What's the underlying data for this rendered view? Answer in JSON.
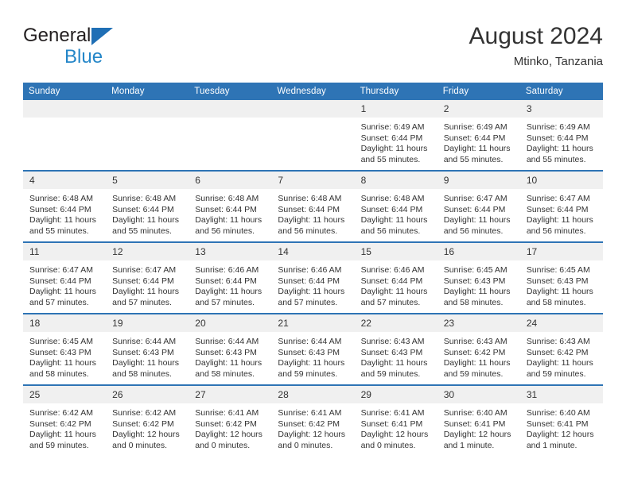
{
  "brand": {
    "name_part1": "General",
    "name_part2": "Blue",
    "mark": "triangle-logo",
    "colors": {
      "dark": "#231f20",
      "blue": "#2486c8",
      "mark": "#1f6fb5"
    }
  },
  "header": {
    "title": "August 2024",
    "location": "Mtinko, Tanzania"
  },
  "theme": {
    "header_blue": "#2e74b5",
    "daynum_band": "#f0f0f0",
    "text": "#333333"
  },
  "calendar": {
    "weekday_headers": [
      "Sunday",
      "Monday",
      "Tuesday",
      "Wednesday",
      "Thursday",
      "Friday",
      "Saturday"
    ],
    "weeks": [
      [
        {
          "day": "",
          "lines": []
        },
        {
          "day": "",
          "lines": []
        },
        {
          "day": "",
          "lines": []
        },
        {
          "day": "",
          "lines": []
        },
        {
          "day": "1",
          "lines": [
            "Sunrise: 6:49 AM",
            "Sunset: 6:44 PM",
            "Daylight: 11 hours and 55 minutes."
          ]
        },
        {
          "day": "2",
          "lines": [
            "Sunrise: 6:49 AM",
            "Sunset: 6:44 PM",
            "Daylight: 11 hours and 55 minutes."
          ]
        },
        {
          "day": "3",
          "lines": [
            "Sunrise: 6:49 AM",
            "Sunset: 6:44 PM",
            "Daylight: 11 hours and 55 minutes."
          ]
        }
      ],
      [
        {
          "day": "4",
          "lines": [
            "Sunrise: 6:48 AM",
            "Sunset: 6:44 PM",
            "Daylight: 11 hours and 55 minutes."
          ]
        },
        {
          "day": "5",
          "lines": [
            "Sunrise: 6:48 AM",
            "Sunset: 6:44 PM",
            "Daylight: 11 hours and 55 minutes."
          ]
        },
        {
          "day": "6",
          "lines": [
            "Sunrise: 6:48 AM",
            "Sunset: 6:44 PM",
            "Daylight: 11 hours and 56 minutes."
          ]
        },
        {
          "day": "7",
          "lines": [
            "Sunrise: 6:48 AM",
            "Sunset: 6:44 PM",
            "Daylight: 11 hours and 56 minutes."
          ]
        },
        {
          "day": "8",
          "lines": [
            "Sunrise: 6:48 AM",
            "Sunset: 6:44 PM",
            "Daylight: 11 hours and 56 minutes."
          ]
        },
        {
          "day": "9",
          "lines": [
            "Sunrise: 6:47 AM",
            "Sunset: 6:44 PM",
            "Daylight: 11 hours and 56 minutes."
          ]
        },
        {
          "day": "10",
          "lines": [
            "Sunrise: 6:47 AM",
            "Sunset: 6:44 PM",
            "Daylight: 11 hours and 56 minutes."
          ]
        }
      ],
      [
        {
          "day": "11",
          "lines": [
            "Sunrise: 6:47 AM",
            "Sunset: 6:44 PM",
            "Daylight: 11 hours and 57 minutes."
          ]
        },
        {
          "day": "12",
          "lines": [
            "Sunrise: 6:47 AM",
            "Sunset: 6:44 PM",
            "Daylight: 11 hours and 57 minutes."
          ]
        },
        {
          "day": "13",
          "lines": [
            "Sunrise: 6:46 AM",
            "Sunset: 6:44 PM",
            "Daylight: 11 hours and 57 minutes."
          ]
        },
        {
          "day": "14",
          "lines": [
            "Sunrise: 6:46 AM",
            "Sunset: 6:44 PM",
            "Daylight: 11 hours and 57 minutes."
          ]
        },
        {
          "day": "15",
          "lines": [
            "Sunrise: 6:46 AM",
            "Sunset: 6:44 PM",
            "Daylight: 11 hours and 57 minutes."
          ]
        },
        {
          "day": "16",
          "lines": [
            "Sunrise: 6:45 AM",
            "Sunset: 6:43 PM",
            "Daylight: 11 hours and 58 minutes."
          ]
        },
        {
          "day": "17",
          "lines": [
            "Sunrise: 6:45 AM",
            "Sunset: 6:43 PM",
            "Daylight: 11 hours and 58 minutes."
          ]
        }
      ],
      [
        {
          "day": "18",
          "lines": [
            "Sunrise: 6:45 AM",
            "Sunset: 6:43 PM",
            "Daylight: 11 hours and 58 minutes."
          ]
        },
        {
          "day": "19",
          "lines": [
            "Sunrise: 6:44 AM",
            "Sunset: 6:43 PM",
            "Daylight: 11 hours and 58 minutes."
          ]
        },
        {
          "day": "20",
          "lines": [
            "Sunrise: 6:44 AM",
            "Sunset: 6:43 PM",
            "Daylight: 11 hours and 58 minutes."
          ]
        },
        {
          "day": "21",
          "lines": [
            "Sunrise: 6:44 AM",
            "Sunset: 6:43 PM",
            "Daylight: 11 hours and 59 minutes."
          ]
        },
        {
          "day": "22",
          "lines": [
            "Sunrise: 6:43 AM",
            "Sunset: 6:43 PM",
            "Daylight: 11 hours and 59 minutes."
          ]
        },
        {
          "day": "23",
          "lines": [
            "Sunrise: 6:43 AM",
            "Sunset: 6:42 PM",
            "Daylight: 11 hours and 59 minutes."
          ]
        },
        {
          "day": "24",
          "lines": [
            "Sunrise: 6:43 AM",
            "Sunset: 6:42 PM",
            "Daylight: 11 hours and 59 minutes."
          ]
        }
      ],
      [
        {
          "day": "25",
          "lines": [
            "Sunrise: 6:42 AM",
            "Sunset: 6:42 PM",
            "Daylight: 11 hours and 59 minutes."
          ]
        },
        {
          "day": "26",
          "lines": [
            "Sunrise: 6:42 AM",
            "Sunset: 6:42 PM",
            "Daylight: 12 hours and 0 minutes."
          ]
        },
        {
          "day": "27",
          "lines": [
            "Sunrise: 6:41 AM",
            "Sunset: 6:42 PM",
            "Daylight: 12 hours and 0 minutes."
          ]
        },
        {
          "day": "28",
          "lines": [
            "Sunrise: 6:41 AM",
            "Sunset: 6:42 PM",
            "Daylight: 12 hours and 0 minutes."
          ]
        },
        {
          "day": "29",
          "lines": [
            "Sunrise: 6:41 AM",
            "Sunset: 6:41 PM",
            "Daylight: 12 hours and 0 minutes."
          ]
        },
        {
          "day": "30",
          "lines": [
            "Sunrise: 6:40 AM",
            "Sunset: 6:41 PM",
            "Daylight: 12 hours and 1 minute."
          ]
        },
        {
          "day": "31",
          "lines": [
            "Sunrise: 6:40 AM",
            "Sunset: 6:41 PM",
            "Daylight: 12 hours and 1 minute."
          ]
        }
      ]
    ]
  }
}
